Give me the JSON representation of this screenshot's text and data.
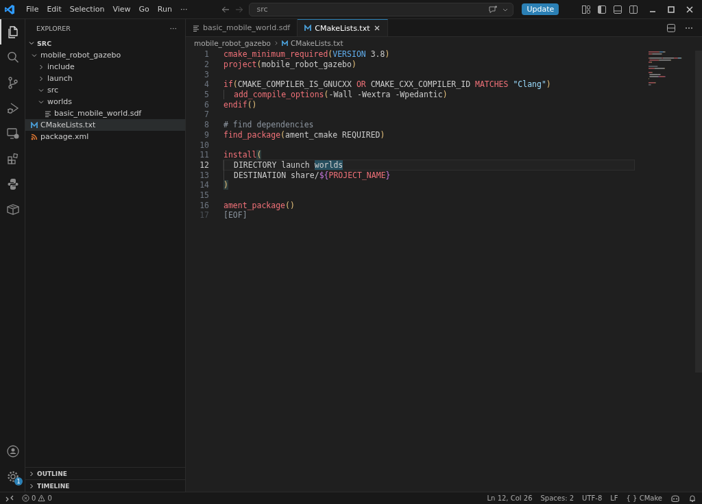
{
  "menu": [
    "File",
    "Edit",
    "Selection",
    "View",
    "Go",
    "Run",
    "···"
  ],
  "command_center": {
    "value": "src"
  },
  "update_button": "Update",
  "activity_bar": [
    {
      "kind": "files",
      "selected": true
    },
    {
      "kind": "search",
      "selected": false
    },
    {
      "kind": "scm",
      "selected": false
    },
    {
      "kind": "debug",
      "selected": false
    },
    {
      "kind": "remote",
      "selected": false
    },
    {
      "kind": "extensions",
      "selected": false
    },
    {
      "kind": "python",
      "selected": false
    },
    {
      "kind": "package",
      "selected": false
    }
  ],
  "settings_badge": "1",
  "sidebar": {
    "title": "EXPLORER",
    "more": "···",
    "root": "SRC",
    "tree": [
      {
        "label": "mobile_robot_gazebo",
        "kind": "folder",
        "expanded": true,
        "selected": false,
        "children": [
          {
            "label": "include",
            "kind": "folder",
            "expanded": false,
            "selected": false
          },
          {
            "label": "launch",
            "kind": "folder",
            "expanded": false,
            "selected": false
          },
          {
            "label": "src",
            "kind": "folder",
            "expanded": true,
            "selected": false
          },
          {
            "label": "worlds",
            "kind": "folder",
            "expanded": true,
            "selected": false,
            "children": [
              {
                "label": "basic_mobile_world.sdf",
                "kind": "text",
                "selected": false
              }
            ]
          }
        ]
      },
      {
        "label": "CMakeLists.txt",
        "kind": "cmake",
        "selected": true
      },
      {
        "label": "package.xml",
        "kind": "rss",
        "selected": false
      }
    ],
    "panels": [
      "OUTLINE",
      "TIMELINE"
    ]
  },
  "tabs": [
    {
      "label": "basic_mobile_world.sdf",
      "kind": "text",
      "selected": false
    },
    {
      "label": "CMakeLists.txt",
      "kind": "cmake",
      "selected": true
    }
  ],
  "breadcrumb": [
    "mobile_robot_gazebo",
    "CMakeLists.txt"
  ],
  "code": [
    {
      "number": "1",
      "current": false,
      "tokens": [
        {
          "kind": "fn",
          "text": "cmake_minimum_required"
        },
        {
          "kind": "paren",
          "text": "("
        },
        {
          "kind": "const",
          "text": "VERSION"
        },
        {
          "kind": "plain",
          "text": " 3.8"
        },
        {
          "kind": "paren",
          "text": ")"
        }
      ]
    },
    {
      "number": "2",
      "current": false,
      "tokens": [
        {
          "kind": "fn",
          "text": "project"
        },
        {
          "kind": "paren",
          "text": "("
        },
        {
          "kind": "plain",
          "text": "mobile_robot_gazebo"
        },
        {
          "kind": "paren",
          "text": ")"
        }
      ]
    },
    {
      "number": "3",
      "current": false
    },
    {
      "number": "4",
      "current": false,
      "tokens": [
        {
          "kind": "fn",
          "text": "if"
        },
        {
          "kind": "paren",
          "text": "("
        },
        {
          "kind": "plain",
          "text": "CMAKE_COMPILER_IS_GNUCXX "
        },
        {
          "kind": "fn",
          "text": "OR"
        },
        {
          "kind": "plain",
          "text": " CMAKE_CXX_COMPILER_ID "
        },
        {
          "kind": "fn",
          "text": "MATCHES "
        },
        {
          "kind": "str",
          "text": "\"Clang\""
        },
        {
          "kind": "paren",
          "text": ")"
        }
      ]
    },
    {
      "number": "5",
      "current": false,
      "indent": true,
      "tokens": [
        {
          "kind": "fn",
          "text": "add_compile_options"
        },
        {
          "kind": "paren",
          "text": "("
        },
        {
          "kind": "plain",
          "text": "-Wall -Wextra -Wpedantic"
        },
        {
          "kind": "paren",
          "text": ")"
        }
      ]
    },
    {
      "number": "6",
      "current": false,
      "tokens": [
        {
          "kind": "fn",
          "text": "endif"
        },
        {
          "kind": "paren",
          "text": "()"
        }
      ]
    },
    {
      "number": "7",
      "current": false
    },
    {
      "number": "8",
      "current": false,
      "tokens": [
        {
          "kind": "comment",
          "text": "# find dependencies"
        }
      ]
    },
    {
      "number": "9",
      "current": false,
      "tokens": [
        {
          "kind": "fn",
          "text": "find_package"
        },
        {
          "kind": "paren",
          "text": "("
        },
        {
          "kind": "plain",
          "text": "ament_cmake REQUIRED"
        },
        {
          "kind": "paren",
          "text": ")"
        }
      ]
    },
    {
      "number": "10",
      "current": false
    },
    {
      "number": "11",
      "current": false,
      "tokens": [
        {
          "kind": "fn",
          "text": "install"
        },
        {
          "kind": "bracket",
          "text": "("
        }
      ]
    },
    {
      "number": "12",
      "current": true,
      "indent": true,
      "tokens": [
        {
          "kind": "plain",
          "text": "DIRECTORY launch "
        },
        {
          "kind": "match",
          "text": "worlds"
        }
      ]
    },
    {
      "number": "13",
      "current": false,
      "indent": true,
      "tokens": [
        {
          "kind": "plain",
          "text": "DESTINATION share/"
        },
        {
          "kind": "var",
          "text": "${"
        },
        {
          "kind": "fn",
          "text": "PROJECT_NAME"
        },
        {
          "kind": "var",
          "text": "}"
        }
      ]
    },
    {
      "number": "14",
      "current": false,
      "tokens": [
        {
          "kind": "bracket",
          "text": ")"
        }
      ]
    },
    {
      "number": "15",
      "current": false
    },
    {
      "number": "16",
      "current": false,
      "tokens": [
        {
          "kind": "fn",
          "text": "ament_package"
        },
        {
          "kind": "paren",
          "text": "()"
        }
      ]
    },
    {
      "number": "17",
      "current": false,
      "tokens": [
        {
          "kind": "eof",
          "text": "[EOF]"
        }
      ]
    }
  ],
  "status_bar": {
    "errors": "0",
    "warnings": "0",
    "items": [
      "Ln 12, Col 26",
      "Spaces: 2",
      "UTF-8",
      "LF"
    ],
    "language": "CMake",
    "language_icon": "{ }"
  }
}
